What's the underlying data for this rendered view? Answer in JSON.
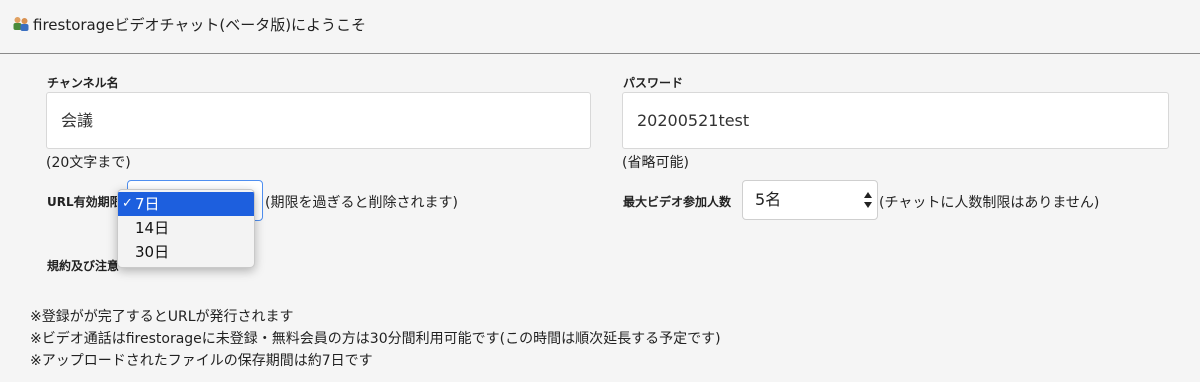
{
  "header": {
    "icon": "users-icon",
    "title": "firestorageビデオチャット(ベータ版)にようこそ"
  },
  "channel": {
    "label": "チャンネル名",
    "value": "会議",
    "hint": "(20文字まで)"
  },
  "password": {
    "label": "パスワード",
    "value": "20200521test",
    "hint": "(省略可能)"
  },
  "url_validity": {
    "label": "URL有効期限",
    "selected": "7日",
    "options": [
      "7日",
      "14日",
      "30日"
    ],
    "note": "(期限を過ぎると削除されます)"
  },
  "max_participants": {
    "label": "最大ビデオ参加人数",
    "selected": "5名",
    "note": "(チャットに人数制限はありません)"
  },
  "terms": {
    "label": "規約及び注意"
  },
  "notices": [
    "※登録がが完了するとURLが発行されます",
    "※ビデオ通話はfirestorageに未登録・無料会員の方は30分間利用可能です(この時間は順次延長する予定です)",
    "※アップロードされたファイルの保存期間は約7日です"
  ],
  "colors": {
    "selected_highlight": "#1d5fde",
    "background": "#f5f5f5"
  }
}
